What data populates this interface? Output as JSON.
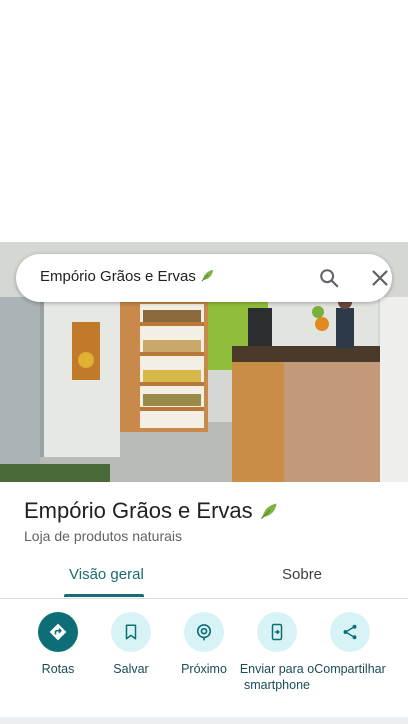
{
  "search": {
    "query": "Empório Grãos e Ervas"
  },
  "place": {
    "name": "Empório Grãos e Ervas",
    "category": "Loja de produtos naturais"
  },
  "tabs": [
    {
      "label": "Visão geral",
      "active": true
    },
    {
      "label": "Sobre",
      "active": false
    }
  ],
  "actions": [
    {
      "label": "Rotas",
      "icon": "directions-icon"
    },
    {
      "label": "Salvar",
      "icon": "bookmark-icon"
    },
    {
      "label": "Próximo",
      "icon": "nearby-icon"
    },
    {
      "label": "Enviar para o smartphone",
      "icon": "send-to-phone-icon"
    },
    {
      "label": "Compartilhar",
      "icon": "share-icon"
    }
  ],
  "colors": {
    "accent": "#1a6b73",
    "action_primary": "#0e6e78",
    "action_bg": "#d8f3f6",
    "leaf": "#7cb342"
  }
}
